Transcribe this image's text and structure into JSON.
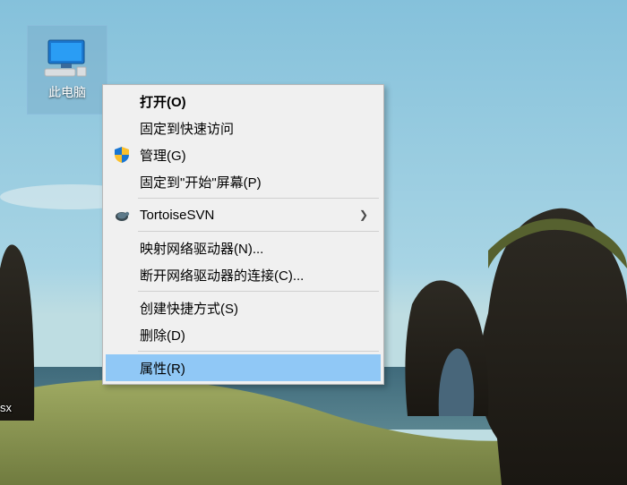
{
  "desktop": {
    "this_pc_label": "此电脑",
    "sx_label": "sx"
  },
  "context_menu": {
    "items": [
      {
        "label": "打开(O)",
        "default": true
      },
      {
        "label": "固定到快速访问"
      },
      {
        "label": "管理(G)",
        "icon": "shield"
      },
      {
        "label": "固定到\"开始\"屏幕(P)"
      },
      {
        "separator": true
      },
      {
        "label": "TortoiseSVN",
        "icon": "tortoise",
        "submenu": true
      },
      {
        "separator": true
      },
      {
        "label": "映射网络驱动器(N)..."
      },
      {
        "label": "断开网络驱动器的连接(C)..."
      },
      {
        "separator": true
      },
      {
        "label": "创建快捷方式(S)"
      },
      {
        "label": "删除(D)"
      },
      {
        "separator": true
      },
      {
        "label": "属性(R)",
        "highlight": true
      }
    ]
  }
}
